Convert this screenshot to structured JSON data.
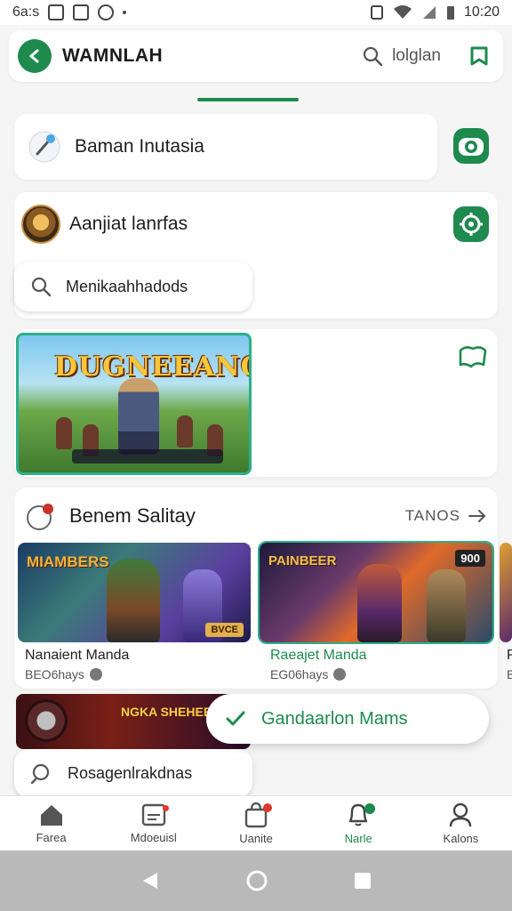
{
  "status_bar": {
    "left_text": "6a:s",
    "time": "10:20"
  },
  "header": {
    "title": "WAMNLAH",
    "search_text": "lolglan"
  },
  "rows": [
    {
      "title": "Baman Inutasia"
    },
    {
      "title": "Aanjiat lanrfas"
    }
  ],
  "search_pill": {
    "text": "Menikaahhadods"
  },
  "feature": {
    "banner_title": "DUGNEEANON"
  },
  "section": {
    "title": "Benem Salitay",
    "see_all": "TANOS"
  },
  "games": [
    {
      "name": "Nanaient Manda",
      "meta": "BEO6hays",
      "banner": "MIAMBERS",
      "badge": "BVCE"
    },
    {
      "name": "Raeajet Manda",
      "meta": "EG06hays",
      "banner": "PAINBEER",
      "badge": "900"
    },
    {
      "name": "P",
      "meta": "B"
    }
  ],
  "promo": {
    "text": "NGKA SHEHEB"
  },
  "second_pill": {
    "text": "Rosagenlrakdnas"
  },
  "toast": {
    "text": "Gandaarlon Mams"
  },
  "bottom_nav": [
    {
      "label": "Farea"
    },
    {
      "label": "Mdoeuisl"
    },
    {
      "label": "Uanite"
    },
    {
      "label": "Narle"
    },
    {
      "label": "Kalons"
    }
  ],
  "colors": {
    "accent": "#1e8a4e",
    "badge": "#e0382e",
    "toast_text": "#1e8a4e"
  }
}
